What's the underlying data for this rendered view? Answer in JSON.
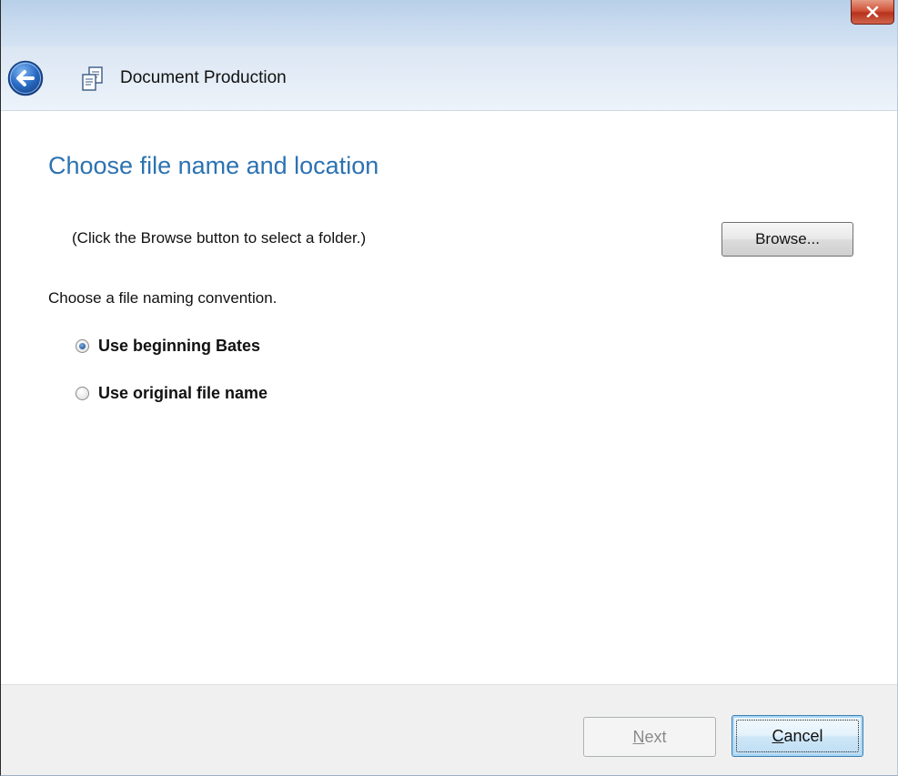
{
  "window": {
    "close_icon": "close-icon"
  },
  "header": {
    "back_icon": "back-arrow-icon",
    "app_icon": "document-production-icon",
    "title": "Document Production"
  },
  "main": {
    "heading": "Choose file name and location",
    "folder_hint": "(Click the Browse button to select a folder.)",
    "browse_label": "Browse...",
    "naming_label": "Choose a file naming convention.",
    "options": [
      {
        "label": "Use beginning Bates",
        "selected": true
      },
      {
        "label": "Use original file name",
        "selected": false
      }
    ]
  },
  "footer": {
    "next_label_accel": "N",
    "next_label_rest": "ext",
    "next_enabled": false,
    "cancel_label_accel": "C",
    "cancel_label_rest": "ancel"
  },
  "colors": {
    "heading": "#2c72b1",
    "back_button": "#2a6bc4"
  }
}
